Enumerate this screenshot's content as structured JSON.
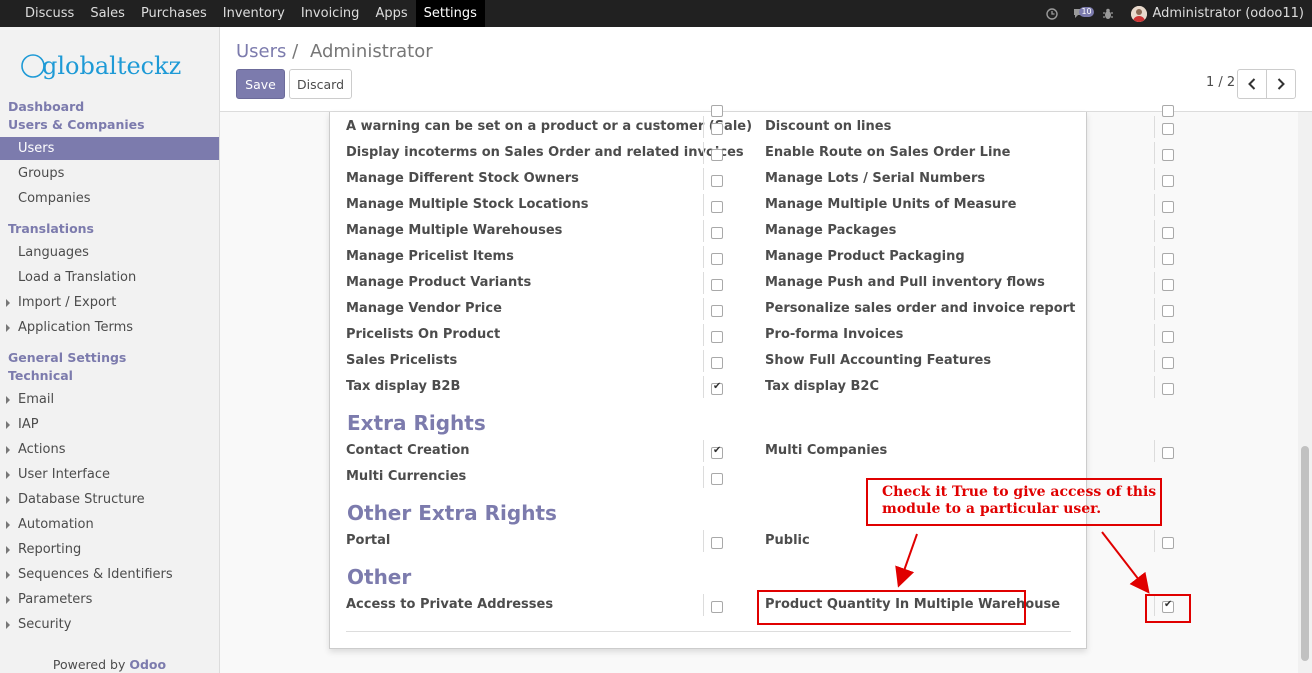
{
  "topbar": {
    "menu": [
      "Discuss",
      "Sales",
      "Purchases",
      "Inventory",
      "Invoicing",
      "Apps",
      "Settings"
    ],
    "active_menu": "Settings",
    "messages_badge": "10",
    "user": "Administrator (odoo11)"
  },
  "sidebar": {
    "logo_text": "globalteckz",
    "sections": [
      {
        "label": "Dashboard",
        "items": []
      },
      {
        "label": "Users & Companies",
        "items": [
          "Users",
          "Groups",
          "Companies"
        ]
      },
      {
        "label": "Translations",
        "items": [
          "Languages",
          "Load a Translation",
          "Import / Export",
          "Application Terms"
        ]
      },
      {
        "label": "General Settings",
        "items": []
      },
      {
        "label": "Technical",
        "items": [
          "Email",
          "IAP",
          "Actions",
          "User Interface",
          "Database Structure",
          "Automation",
          "Reporting",
          "Sequences & Identifiers",
          "Parameters",
          "Security"
        ]
      }
    ],
    "active_item": "Users",
    "powered_prefix": "Powered by ",
    "powered_brand": "Odoo"
  },
  "control_panel": {
    "breadcrumb_parent": "Users",
    "breadcrumb_sep": "/",
    "breadcrumb_current": "Administrator",
    "save_label": "Save",
    "discard_label": "Discard",
    "pager": "1 / 2"
  },
  "form": {
    "technical_rights": [
      {
        "label": "A warning can be set on a product or a customer (Sale)",
        "checked": false
      },
      {
        "label": "Discount on lines",
        "checked": false
      },
      {
        "label": "Display incoterms on Sales Order and related invoices",
        "checked": false
      },
      {
        "label": "Enable Route on Sales Order Line",
        "checked": false
      },
      {
        "label": "Manage Different Stock Owners",
        "checked": false
      },
      {
        "label": "Manage Lots / Serial Numbers",
        "checked": false
      },
      {
        "label": "Manage Multiple Stock Locations",
        "checked": false
      },
      {
        "label": "Manage Multiple Units of Measure",
        "checked": false
      },
      {
        "label": "Manage Multiple Warehouses",
        "checked": false
      },
      {
        "label": "Manage Packages",
        "checked": false
      },
      {
        "label": "Manage Pricelist Items",
        "checked": false
      },
      {
        "label": "Manage Product Packaging",
        "checked": false
      },
      {
        "label": "Manage Product Variants",
        "checked": false
      },
      {
        "label": "Manage Push and Pull inventory flows",
        "checked": false
      },
      {
        "label": "Manage Vendor Price",
        "checked": false
      },
      {
        "label": "Personalize sales order and invoice report",
        "checked": false
      },
      {
        "label": "Pricelists On Product",
        "checked": false
      },
      {
        "label": "Pro-forma Invoices",
        "checked": false
      },
      {
        "label": "Sales Pricelists",
        "checked": false
      },
      {
        "label": "Show Full Accounting Features",
        "checked": false
      },
      {
        "label": "Tax display B2B",
        "checked": true
      },
      {
        "label": "Tax display B2C",
        "checked": false
      }
    ],
    "extra_rights_title": "Extra Rights",
    "extra_rights": [
      {
        "label": "Contact Creation",
        "checked": true
      },
      {
        "label": "Multi Companies",
        "checked": false
      },
      {
        "label": "Multi Currencies",
        "checked": false
      }
    ],
    "other_extra_rights_title": "Other Extra Rights",
    "other_extra_rights": [
      {
        "label": "Portal",
        "checked": false
      },
      {
        "label": "Public",
        "checked": false
      }
    ],
    "other_title": "Other",
    "other": [
      {
        "label": "Access to Private Addresses",
        "checked": false
      },
      {
        "label": "Product Quantity In Multiple Warehouse",
        "checked": true
      }
    ]
  },
  "annotation": {
    "text": "Check it True to give access of this module to a particular user.",
    "color": "#e00000"
  },
  "colors": {
    "accent": "#7c7bad",
    "topbar": "#212121"
  }
}
